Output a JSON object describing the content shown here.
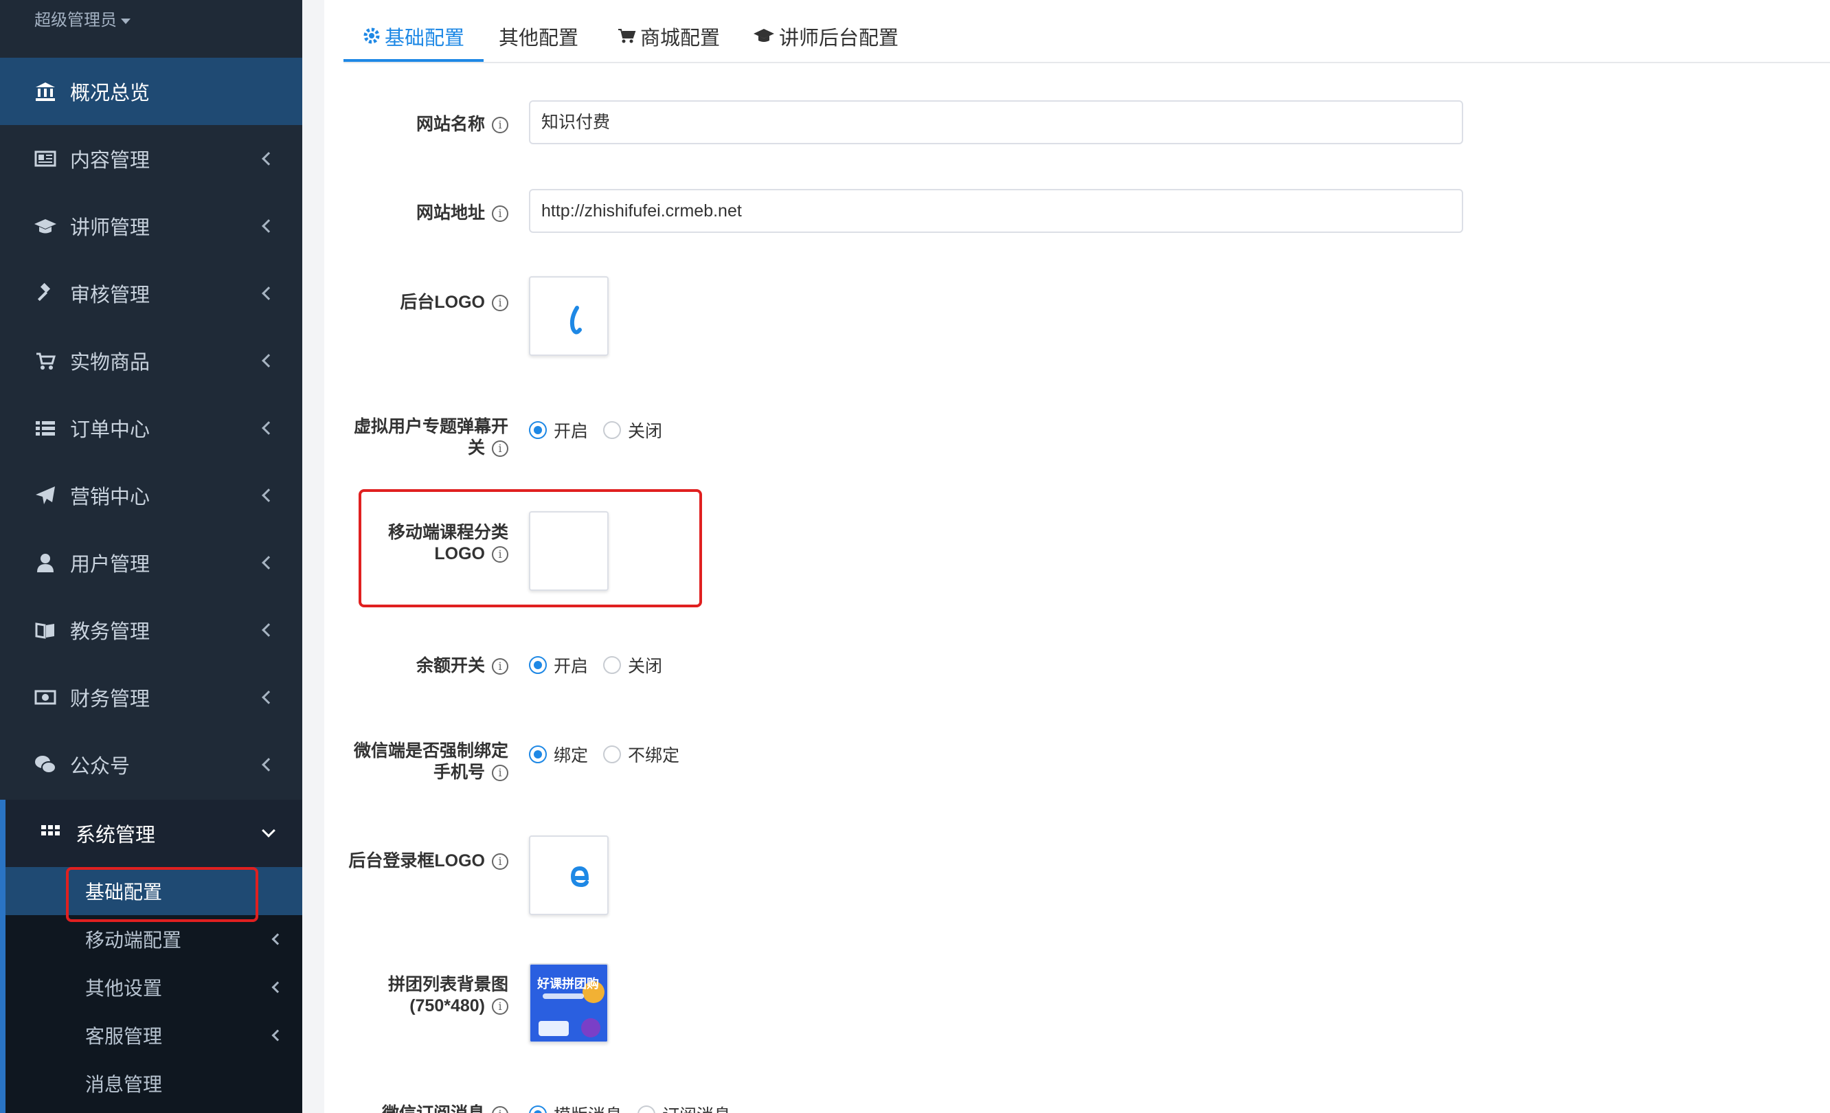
{
  "sidebar": {
    "user": "超级管理员",
    "items": [
      {
        "label": "概况总览",
        "icon": "bank-icon"
      },
      {
        "label": "内容管理",
        "icon": "newspaper-icon"
      },
      {
        "label": "讲师管理",
        "icon": "graduation-cap-icon"
      },
      {
        "label": "审核管理",
        "icon": "gavel-icon"
      },
      {
        "label": "实物商品",
        "icon": "cart-icon"
      },
      {
        "label": "订单中心",
        "icon": "list-icon"
      },
      {
        "label": "营销中心",
        "icon": "paper-plane-icon"
      },
      {
        "label": "用户管理",
        "icon": "user-icon"
      },
      {
        "label": "教务管理",
        "icon": "book-icon"
      },
      {
        "label": "财务管理",
        "icon": "money-icon"
      },
      {
        "label": "公众号",
        "icon": "wechat-icon"
      },
      {
        "label": "系统管理",
        "icon": "grid-icon"
      }
    ],
    "submenu": [
      {
        "label": "基础配置"
      },
      {
        "label": "移动端配置"
      },
      {
        "label": "其他设置"
      },
      {
        "label": "客服管理"
      },
      {
        "label": "消息管理"
      }
    ]
  },
  "tabs": [
    {
      "label": "基础配置"
    },
    {
      "label": "其他配置"
    },
    {
      "label": "商城配置"
    },
    {
      "label": "讲师后台配置"
    }
  ],
  "form": {
    "site_name": {
      "label": "网站名称",
      "value": "知识付费"
    },
    "site_url": {
      "label": "网站地址",
      "value": "http://zhishifufei.crmeb.net"
    },
    "admin_logo": {
      "label": "后台LOGO"
    },
    "barrage": {
      "label_line1": "虚拟用户专题弹幕开",
      "label_line2": "关",
      "options": [
        "开启",
        "关闭"
      ],
      "selected": "开启"
    },
    "mobile_logo": {
      "label_line1": "移动端课程分类",
      "label_line2": "LOGO"
    },
    "balance": {
      "label": "余额开关",
      "options": [
        "开启",
        "关闭"
      ],
      "selected": "开启"
    },
    "bind_phone": {
      "label_line1": "微信端是否强制绑定",
      "label_line2": "手机号",
      "options": [
        "绑定",
        "不绑定"
      ],
      "selected": "绑定"
    },
    "login_logo": {
      "label": "后台登录框LOGO"
    },
    "group_bg": {
      "label_line1": "拼团列表背景图",
      "label_line2": "(750*480)",
      "image_text": "好课拼团购"
    },
    "notice": {
      "label": "微信订阅消息",
      "options": [
        "模版消息",
        "订阅消息"
      ],
      "selected": "模版消息"
    }
  },
  "colors": {
    "accent": "#1e88e5",
    "sidebar_bg": "#1f2a37",
    "highlight": "#e02020"
  }
}
